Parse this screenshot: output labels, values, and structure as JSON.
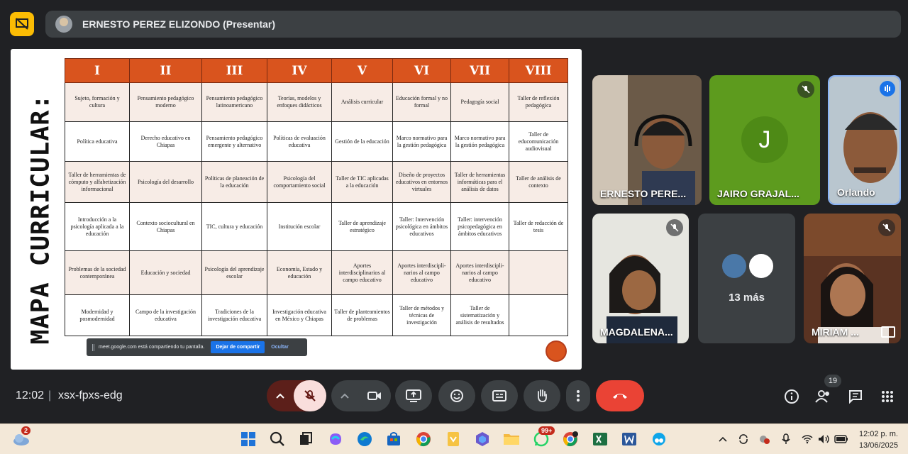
{
  "presenter": {
    "label": "ERNESTO PEREZ ELIZONDO (Presentar)",
    "accent": "#fbbc04"
  },
  "slide": {
    "vertical_title": "MAPA CURRICULAR:",
    "columns": [
      "I",
      "II",
      "III",
      "IV",
      "V",
      "VI",
      "VII",
      "VIII"
    ],
    "rows": [
      [
        "Sujeto, formación y cultura",
        "Pensamiento pedagógico moderno",
        "Pensamiento pedagógico latinoamericano",
        "Teorías, modelos y enfoques didácticos",
        "Análisis curricular",
        "Educación formal y no formal",
        "Pedagogía social",
        "Taller de reflexión pedagógica"
      ],
      [
        "Política educativa",
        "Derecho educativo en Chiapas",
        "Pensamiento pedagógico emergente y alternativo",
        "Políticas de evaluación educativa",
        "Gestión de la educación",
        "Marco normativo para la gestión pedagógica",
        "Marco normativo para la gestión pedagógica",
        "Taller de educomunicación audiovisual"
      ],
      [
        "Taller de herramientas de cómputo y alfabetización informacional",
        "Psicología del desarrollo",
        "Políticas de planeación de la educación",
        "Psicología del comportamiento social",
        "Taller de TIC aplicadas a la educación",
        "Diseño de proyectos educativos en entornos virtuales",
        "Taller de herramientas informáticas para el análisis de datos",
        "Taller de análisis de contexto"
      ],
      [
        "Introducción a la psicología aplicada a la educación",
        "Contexto sociocultural en Chiapas",
        "TIC, cultura y educación",
        "Institución escolar",
        "Taller de aprendizaje estratégico",
        "Taller: Intervención psicológica en ámbitos educativos",
        "Taller: intervención psicopedagógica en ámbitos educativos",
        "Taller de redacción de tesis"
      ],
      [
        "Problemas de la sociedad contemporánea",
        "Educación y sociedad",
        "Psicología del aprendizaje escolar",
        "Economía, Estado y educación",
        "Aportes interdisciplinarios al campo educativo",
        "Aportes interdiscipli-narios al campo educativo",
        "Aportes interdiscipli-narios al campo educativo",
        ""
      ],
      [
        "Modernidad y posmodernidad",
        "Campo de la investigación educativa",
        "Tradiciones de la investigación educativa",
        "Investigación educativa en México y Chiapas",
        "Taller de planteamientos de problemas",
        "Taller de métodos y técnicas de investigación",
        "Taller de sistematización y análisis de resultados",
        ""
      ]
    ],
    "header_color": "#d9541e",
    "share_banner": {
      "text": "meet.google.com está compartiendo tu pantalla.",
      "stop_label": "Dejar de compartir",
      "hide_label": "Ocultar"
    }
  },
  "participants": [
    {
      "name": "ERNESTO PERE...",
      "muted": false
    },
    {
      "name": "JAIRO GRAJAL...",
      "muted": true,
      "initial": "J",
      "avatar_color": "#5d9b1e"
    },
    {
      "name": "Orlando",
      "muted": false,
      "speaking": true
    },
    {
      "name": "MAGDALENA...",
      "muted": true
    },
    {
      "name": "13 más",
      "muted": false
    },
    {
      "name": "MIRIAM ...",
      "muted": true
    }
  ],
  "meeting": {
    "time": "12:02",
    "separator": "|",
    "code": "xsx-fpxs-edg",
    "participant_count": "19"
  },
  "taskbar": {
    "weather_badge": "2",
    "whatsapp_badge": "99+",
    "time": "12:02 p. m.",
    "date": "13/06/2025"
  }
}
